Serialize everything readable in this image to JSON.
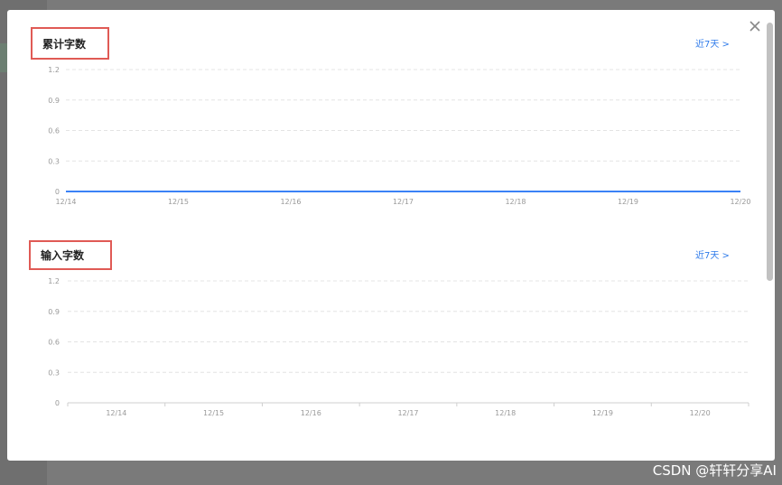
{
  "modal": {
    "close_symbol": "×",
    "close_icon": "close-icon"
  },
  "panels": [
    {
      "title": "累计字数",
      "range_link": "近7天 >"
    },
    {
      "title": "输入字数",
      "range_link": "近7天 >"
    }
  ],
  "colors": {
    "accent": "#2f7bea",
    "line": "#3b82f6",
    "highlight_border": "#e05a55",
    "grid": "#e4e4e4",
    "tick": "#999999"
  },
  "chart_data": [
    {
      "type": "line",
      "x": [
        "12/14",
        "12/15",
        "12/16",
        "12/17",
        "12/18",
        "12/19",
        "12/20"
      ],
      "series": [
        {
          "values": [
            0,
            0,
            0,
            0,
            0,
            0,
            0
          ]
        }
      ],
      "yticks": [
        "0",
        "0.3",
        "0.6",
        "0.9",
        "1.2"
      ],
      "ylim": [
        0,
        1.2
      ],
      "grid": true,
      "title": "",
      "xlabel": "",
      "ylabel": ""
    },
    {
      "type": "bar",
      "x": [
        "12/14",
        "12/15",
        "12/16",
        "12/17",
        "12/18",
        "12/19",
        "12/20"
      ],
      "series": [
        {
          "values": [
            0,
            0,
            0,
            0,
            0,
            0,
            0
          ]
        }
      ],
      "yticks": [
        "0",
        "0.3",
        "0.6",
        "0.9",
        "1.2"
      ],
      "ylim": [
        0,
        1.2
      ],
      "grid": true,
      "title": "",
      "xlabel": "",
      "ylabel": ""
    }
  ],
  "watermark": "CSDN @轩轩分享AI"
}
